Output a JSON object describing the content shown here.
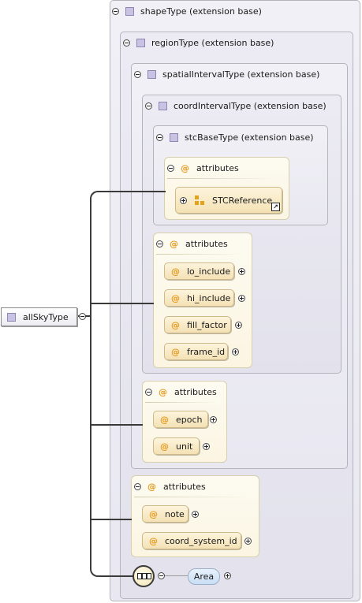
{
  "root": {
    "label": "allSkyType"
  },
  "extensions": [
    {
      "label": "shapeType (extension base)"
    },
    {
      "label": "regionType (extension base)"
    },
    {
      "label": "spatialIntervalType (extension base)"
    },
    {
      "label": "coordIntervalType (extension base)"
    },
    {
      "label": "stcBaseType (extension base)"
    }
  ],
  "attribute_groups": [
    {
      "label": "attributes",
      "items": [
        "STCReference"
      ]
    },
    {
      "label": "attributes",
      "items": [
        "lo_include",
        "hi_include",
        "fill_factor",
        "frame_id"
      ]
    },
    {
      "label": "attributes",
      "items": [
        "epoch",
        "unit"
      ]
    },
    {
      "label": "attributes",
      "items": [
        "note",
        "coord_system_id"
      ]
    }
  ],
  "sequence": {
    "element": "Area"
  },
  "colors": {
    "extension_square": "#c9c2e2",
    "attribute_symbol": "#e89a1c",
    "element_pill": "#d6e8f8"
  }
}
